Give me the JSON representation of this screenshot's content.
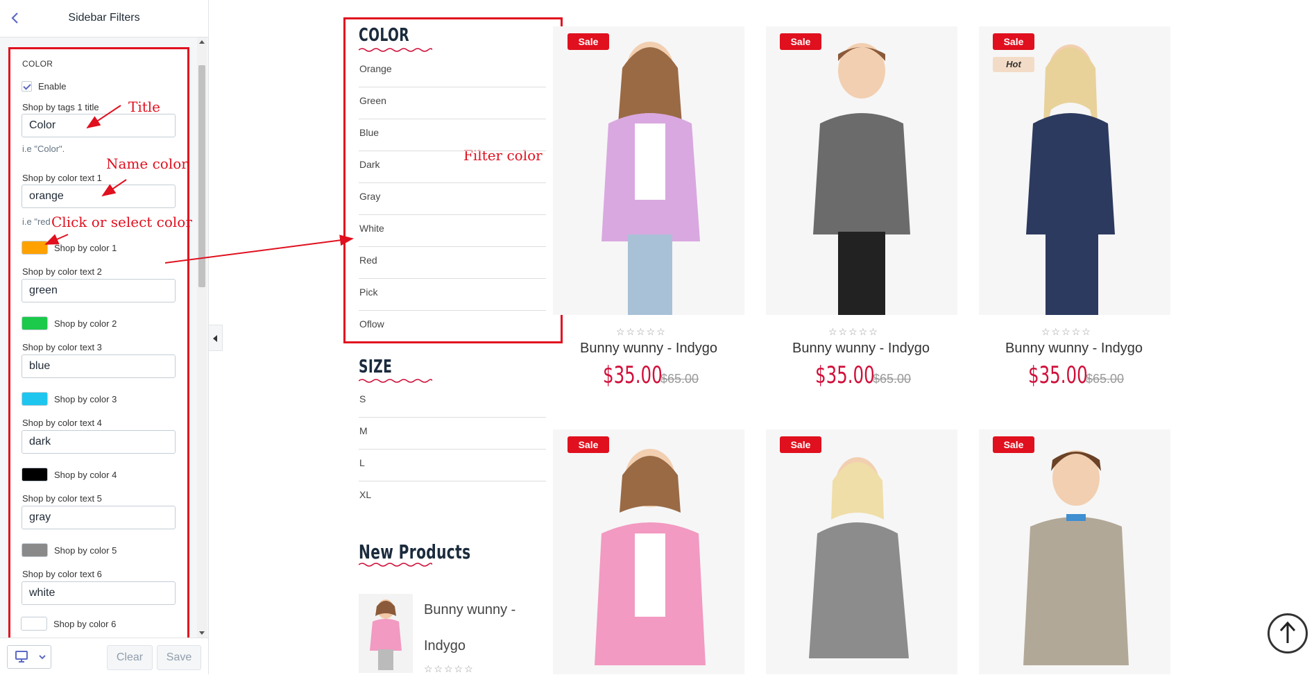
{
  "panel": {
    "title": "Sidebar Filters",
    "section_title": "COLOR",
    "enable_label": "Enable",
    "enable_checked": true,
    "tags_title_label": "Shop by tags 1 title",
    "tags_title_value": "Color",
    "tags_title_help": "i.e \"Color\".",
    "color_help_partial": "i.e \"red",
    "colors": [
      {
        "text_label": "Shop by color text 1",
        "text_value": "orange",
        "swatch_label": "Shop by color 1",
        "swatch_color": "#ffa200"
      },
      {
        "text_label": "Shop by color text 2",
        "text_value": "green",
        "swatch_label": "Shop by color 2",
        "swatch_color": "#1bc94b"
      },
      {
        "text_label": "Shop by color text 3",
        "text_value": "blue",
        "swatch_label": "Shop by color 3",
        "swatch_color": "#1ec6ef"
      },
      {
        "text_label": "Shop by color text 4",
        "text_value": "dark",
        "swatch_label": "Shop by color 4",
        "swatch_color": "#000000"
      },
      {
        "text_label": "Shop by color text 5",
        "text_value": "gray",
        "swatch_label": "Shop by color 5",
        "swatch_color": "#8a8a8a"
      },
      {
        "text_label": "Shop by color text 6",
        "text_value": "white",
        "swatch_label": "Shop by color 6",
        "swatch_color": "#ffffff"
      }
    ],
    "footer": {
      "clear_label": "Clear",
      "save_label": "Save",
      "device_icon": "desktop-icon"
    }
  },
  "annotations": {
    "title": "Title",
    "name_color": "Name color",
    "click_color": "Click or select color",
    "filter_color": "Filter color"
  },
  "storefront": {
    "color_widget": {
      "title": "COLOR",
      "items": [
        "Orange",
        "Green",
        "Blue",
        "Dark",
        "Gray",
        "White",
        "Red",
        "Pick",
        "Oflow"
      ]
    },
    "size_widget": {
      "title": "SIZE",
      "items": [
        "S",
        "M",
        "L",
        "XL"
      ]
    },
    "new_products": {
      "title": "New Products",
      "item_name_line1": "Bunny wunny -",
      "item_name_line2": "Indygo"
    },
    "products": [
      {
        "name": "Bunny wunny - Indygo",
        "price": "$35.00",
        "old_price": "$65.00",
        "badges": [
          "Sale"
        ]
      },
      {
        "name": "Bunny wunny - Indygo",
        "price": "$35.00",
        "old_price": "$65.00",
        "badges": [
          "Sale"
        ]
      },
      {
        "name": "Bunny wunny - Indygo",
        "price": "$35.00",
        "old_price": "$65.00",
        "badges": [
          "Sale",
          "Hot"
        ]
      },
      {
        "badges": [
          "Sale"
        ]
      },
      {
        "badges": [
          "Sale"
        ]
      },
      {
        "badges": [
          "Sale"
        ]
      }
    ],
    "stars": "☆☆☆☆☆"
  },
  "colors": {
    "accent_red": "#e0101e",
    "price_red": "#d0103a",
    "shopify_purple": "#5c6ac4"
  }
}
